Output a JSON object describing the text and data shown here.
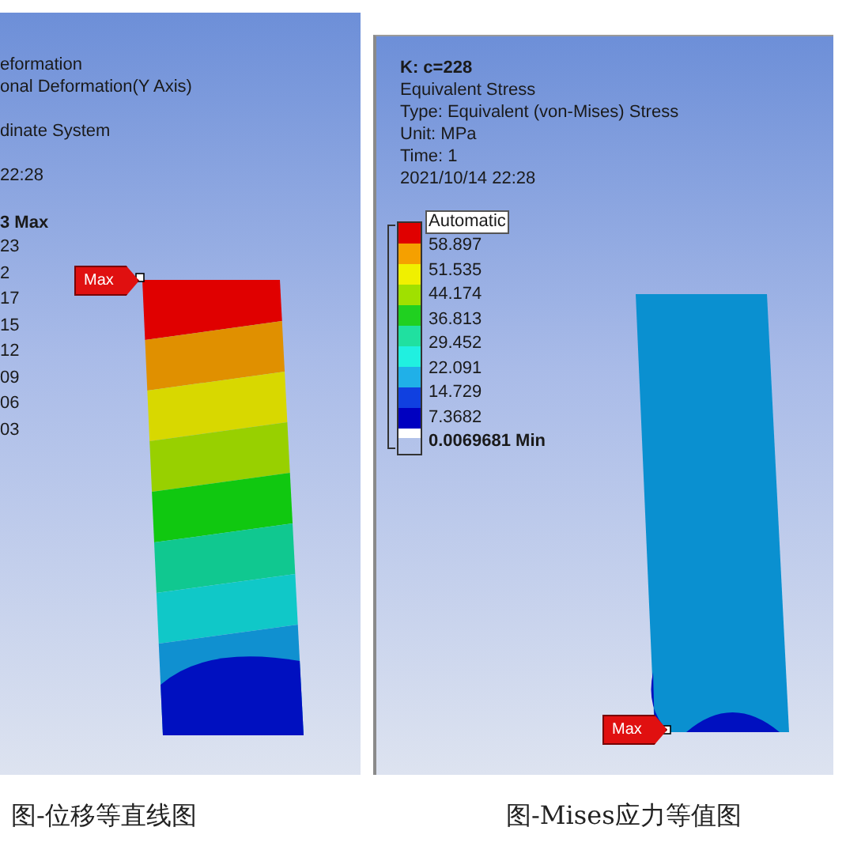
{
  "left_panel": {
    "info_groups": [
      [
        "eformation",
        "onal Deformation(Y Axis)"
      ],
      [
        "dinate System"
      ],
      [
        "22:28"
      ]
    ],
    "legend_header": "3 Max",
    "legend_values": [
      "23",
      "2",
      "17",
      "15",
      "12",
      "09",
      "06",
      "03"
    ],
    "max_label": "Max"
  },
  "right_panel": {
    "title": "K: c=228",
    "info_lines": [
      "Equivalent Stress",
      "Type: Equivalent (von-Mises) Stress",
      "Unit: MPa",
      "Time: 1",
      "2021/10/14 22:28"
    ],
    "legend": {
      "swatches": [
        {
          "color": "#e00000"
        },
        {
          "color": "#f5a000"
        },
        {
          "color": "#f0f000"
        },
        {
          "color": "#a0e000"
        },
        {
          "color": "#20d020"
        },
        {
          "color": "#20e0a0"
        },
        {
          "color": "#20f0e0"
        },
        {
          "color": "#20b0e8"
        },
        {
          "color": "#1040e0"
        },
        {
          "color": "#0000c0"
        },
        {
          "color": "#ffffff"
        }
      ],
      "mode_label": "Automatic",
      "labels": [
        "58.897",
        "51.535",
        "44.174",
        "36.813",
        "29.452",
        "22.091",
        "14.729",
        "7.3682"
      ],
      "min_label": "0.0069681 Min"
    },
    "max_label": "Max"
  },
  "captions": [
    "图-位移等直线图",
    "图-Mises应力等值图"
  ]
}
